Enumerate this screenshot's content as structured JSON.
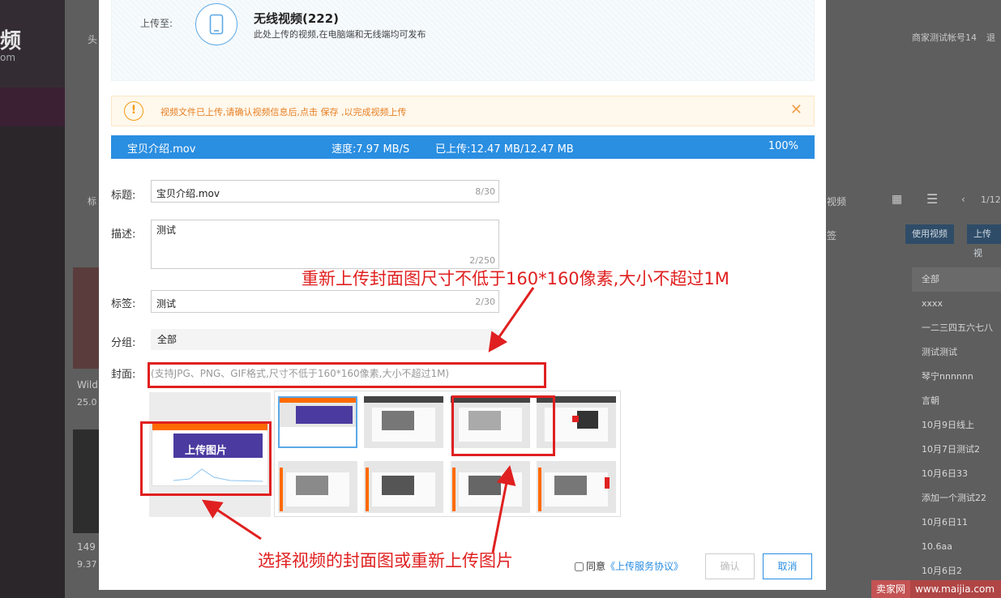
{
  "background": {
    "logo": "频",
    "logo_sub": "om",
    "header_nav": "头",
    "account_text": "商家测试帐号14",
    "logout_text": "退",
    "left_label": "标",
    "left_label2": "25.0",
    "card1_title": "Wild",
    "card1_date": "25.0",
    "card2_title": "149",
    "card2_date": "9.37",
    "toolbar_filter": "视频",
    "toolbar_pager": "1/12",
    "search_suffix": "签",
    "use_video_btn": "使用视频",
    "upload_btn": "上传视",
    "right_list": [
      "全部",
      "xxxx",
      "一二三四五六七八",
      "测试测试",
      "琴宁nnnnnn",
      "言朝",
      "10月9日线上",
      "10月7日测试2",
      "10月6日33",
      "添加一个测试22",
      "10月6日11",
      "10.6aa",
      "10月6日2"
    ]
  },
  "watermark": {
    "brand": "卖家网",
    "url": "www.maijia.com"
  },
  "modal": {
    "upload_to_label": "上传至:",
    "channel_title": "无线视频(222)",
    "channel_desc": "此处上传的视频,在电脑端和无线端均可发布",
    "notice_text": "视频文件已上传,请确认视频信息后,点击 保存 ,以完成视频上传",
    "progress": {
      "filename": "宝贝介绍.mov",
      "speed": "速度:7.97 MB/S",
      "uploaded": "已上传:12.47 MB/12.47 MB",
      "percent_text": "100%",
      "percent": 100
    },
    "form": {
      "title_label": "标题:",
      "title_value": "宝贝介绍.mov",
      "title_count": "8/30",
      "desc_label": "描述:",
      "desc_value": "测试",
      "desc_count": "2/250",
      "tags_label": "标签:",
      "tags_value": "测试",
      "tags_count": "2/30",
      "group_label": "分组:",
      "group_value": "全部",
      "cover_label": "封面:",
      "cover_hint": "(支持JPG、PNG、GIF格式,尺寸不低于160*160像素,大小不超过1M)",
      "cover_upload_text": "上传图片"
    },
    "footer": {
      "agree_label": "同意",
      "agreement_link": "《上传服务协议》",
      "confirm_label": "确认",
      "cancel_label": "取消"
    }
  },
  "annotations": {
    "top_note": "重新上传封面图尺寸不低于160*160像素,大小不超过1M",
    "bottom_note": "选择视频的封面图或重新上传图片",
    "color": "#e02020"
  },
  "colors": {
    "accent": "#2a8ee1",
    "warning": "#f39c12",
    "annotation": "#e02020"
  }
}
